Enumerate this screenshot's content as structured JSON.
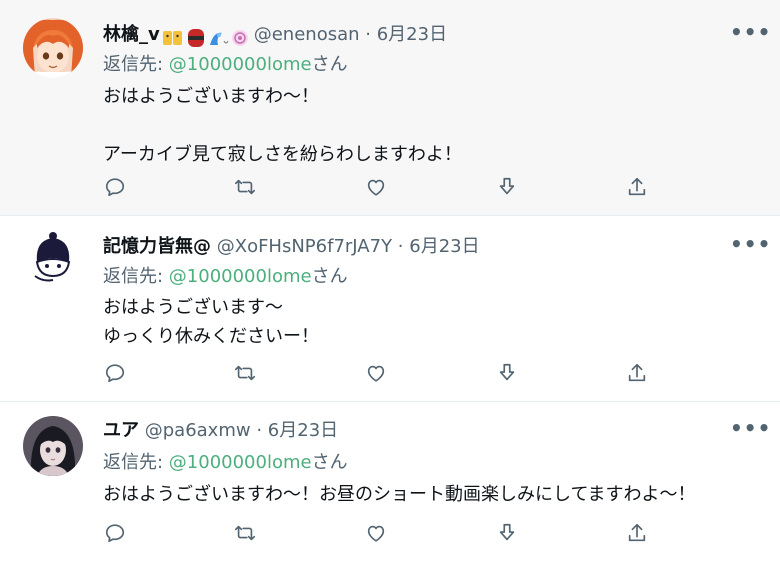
{
  "tweets": [
    {
      "name": "林檎_v",
      "handle": "@enenosan",
      "separator": "·",
      "date": "6月23日",
      "reply_prefix": "返信先: ",
      "reply_to": "@1000000lome",
      "reply_suffix": "さん",
      "text": "おはようございますわ～！\n\nアーカイブ見て寂しさを紛らわしますわよ！",
      "avatar_icon": "anime-orange-hair-avatar"
    },
    {
      "name": "記憶力皆無@",
      "handle": "@XoFHsNP6f7rJA7Y",
      "separator": "·",
      "date": "6月23日",
      "reply_prefix": "返信先: ",
      "reply_to": "@1000000lome",
      "reply_suffix": "さん",
      "text": "おはようございます～\nゆっくり休みくださいー！",
      "avatar_icon": "doodle-face-avatar"
    },
    {
      "name": "ユア",
      "handle": "@pa6axmw",
      "separator": "·",
      "date": "6月23日",
      "reply_prefix": "返信先: ",
      "reply_to": "@1000000lome",
      "reply_suffix": "さん",
      "text": "おはようございますわ～！お昼のショート動画楽しみにしてますわよ～！",
      "avatar_icon": "dark-hair-girl-avatar"
    }
  ],
  "more_label": "•••",
  "colors": {
    "mention": "#4caf7d",
    "muted": "#536471",
    "text": "#0f1419",
    "highlight_bg": "#f7f7f8",
    "divider": "#e6ecf0"
  },
  "action_icons": [
    "reply-icon",
    "retweet-icon",
    "like-icon",
    "download-icon",
    "share-icon"
  ]
}
